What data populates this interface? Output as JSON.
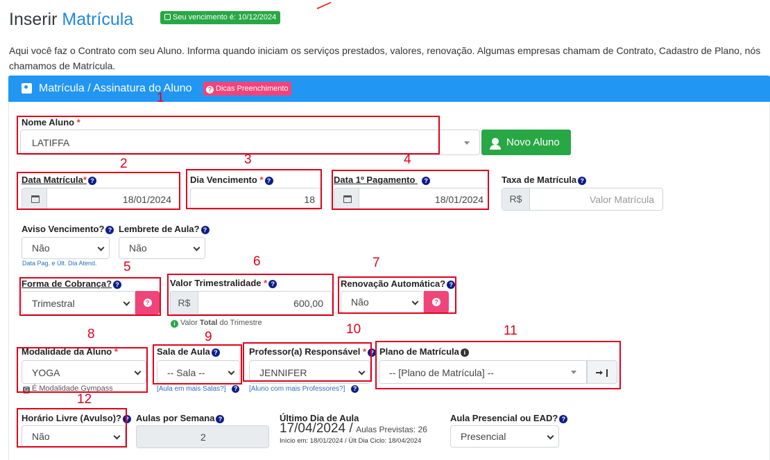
{
  "header": {
    "title_prefix": "Inserir",
    "title_accent": "Matrícula",
    "due_badge": "Seu vencimento é: 10/12/2024",
    "description": "Aqui você faz o Contrato com seu Aluno. Informa quando iniciam os serviços prestados, valores, renovação. Algumas empresas chamam de Contrato, Cadastro de Plano, nós chamamos de Matrícula."
  },
  "card": {
    "title": "Matrícula / Assinatura do Aluno",
    "tips_badge": "Dicas Preenchimento"
  },
  "annotations": [
    "1",
    "2",
    "3",
    "4",
    "5",
    "6",
    "7",
    "8",
    "9",
    "10",
    "11",
    "12"
  ],
  "fields": {
    "nome_aluno": {
      "label": "Nome Aluno",
      "value": "LATIFFA"
    },
    "novo_aluno": {
      "label": "Novo Aluno"
    },
    "data_matricula": {
      "label": "Data Matrícula",
      "value": "18/01/2024"
    },
    "dia_vencimento": {
      "label": "Dia Vencimento",
      "value": "18"
    },
    "data_pagamento": {
      "label": "Data 1º Pagamento",
      "value": "18/01/2024"
    },
    "taxa_matricula": {
      "label": "Taxa de Matrícula",
      "prefix": "R$",
      "placeholder": "Valor Matrícula"
    },
    "aviso_vencimento": {
      "label": "Aviso Vencimento?",
      "value": "Não",
      "hint": "Data Pag. e Últ. Dia Atend."
    },
    "lembrete_aula": {
      "label": "Lembrete de Aula?",
      "value": "Não"
    },
    "forma_cobranca": {
      "label": "Forma de Cobrança?",
      "value": "Trimestral"
    },
    "valor_trimestralidade": {
      "label": "Valor Trimestralidade",
      "prefix": "R$",
      "value": "600,00",
      "hint_pre": "Valor ",
      "hint_bold": "Total",
      "hint_post": " do Trimestre"
    },
    "renovacao": {
      "label": "Renovação Automática?",
      "value": "Não"
    },
    "modalidade": {
      "label": "Modalidade da Aluno",
      "value": "YOGA",
      "hint": "É Modalidade Gympass"
    },
    "sala": {
      "label": "Sala de Aula",
      "value": "-- Sala --",
      "hint": "[Aula em mais Salas?]"
    },
    "professor": {
      "label": "Professor(a) Responsável",
      "value": "JENNIFER",
      "hint": "[Aluno com mais Professores?]"
    },
    "plano": {
      "label": "Plano de Matrícula",
      "value": "-- [Plano de Matrícula] --"
    },
    "horario_livre": {
      "label": "Horário Livre (Avulso)?",
      "value": "Não"
    },
    "aulas_semana": {
      "label": "Aulas por Semana",
      "value": "2"
    },
    "ultimo_dia": {
      "label": "Último Dia de Aula",
      "date": "17/04/2024 /",
      "previstas": "Aulas Previstas: 26",
      "ciclo": "Início em: 18/01/2024 / Últ Dia Ciclo: 18/04/2024"
    },
    "presencial": {
      "label": "Aula Presencial ou EAD?",
      "value": "Presencial"
    }
  },
  "colors": {
    "primary": "#2196f3",
    "success": "#28a745",
    "pink": "#f0457a",
    "annotation_red": "#e0001b"
  }
}
